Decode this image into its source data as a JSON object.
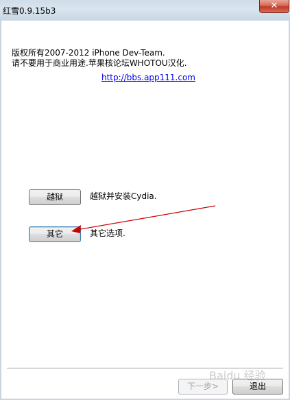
{
  "window": {
    "title": "红雪0.9.15b3",
    "close_label": "✕"
  },
  "info": {
    "copyright": "版权所有2007-2012 iPhone Dev-Team.",
    "notice": "请不要用于商业用途.苹果核论坛WHOTOU汉化.",
    "link": "http://bbs.app111.com"
  },
  "actions": {
    "jailbreak_label": "越狱",
    "jailbreak_desc": "越狱并安装Cydia.",
    "other_label": "其它",
    "other_desc": "其它选项."
  },
  "footer": {
    "next_label": "下一步>",
    "exit_label": "退出",
    "watermark": "Baidu 经验"
  },
  "colors": {
    "arrow": "#cc0000",
    "link": "#0000ee"
  }
}
